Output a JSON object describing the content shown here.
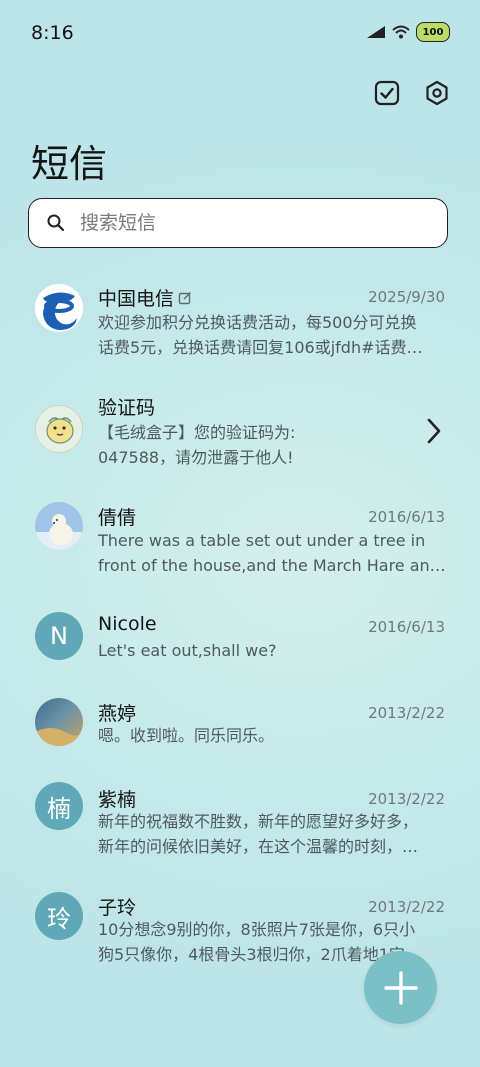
{
  "status": {
    "time": "8:16",
    "battery": "100"
  },
  "header": {
    "title": "短信"
  },
  "search": {
    "placeholder": "搜索短信"
  },
  "messages": [
    {
      "name": "中国电信",
      "date": "2025/9/30",
      "line1": "欢迎参加积分兑换话费活动，每500分可兑换",
      "line2": "话费5元，兑换话费请回复106或jfdh#话费…"
    },
    {
      "name": "验证码",
      "date": "",
      "line1": "【毛绒盒子】您的验证码为:",
      "line2": "047588，请勿泄露于他人!"
    },
    {
      "name": "倩倩",
      "date": "2016/6/13",
      "line1": "There was a table set out under a tree in",
      "line2": "front of the house,and the March Hare an…"
    },
    {
      "name": "Nicole",
      "date": "2016/6/13",
      "avatar_letter": "N",
      "line1": "Let's eat out,shall we?"
    },
    {
      "name": "燕婷",
      "date": "2013/2/22",
      "line1": "嗯。收到啦。同乐同乐。"
    },
    {
      "name": "紫楠",
      "date": "2013/2/22",
      "avatar_letter": "楠",
      "line1": "新年的祝福数不胜数，新年的愿望好多好多，",
      "line2": "新年的问候依旧美好，在这个温馨的时刻，…"
    },
    {
      "name": "子玲",
      "date": "2013/2/22",
      "avatar_letter": "玲",
      "line1": "10分想念9别的你，8张照片7张是你，6只小",
      "line2": "狗5只像你，4根骨头3根归你，2爪着地1定…"
    }
  ],
  "icons": {
    "signal": "signal-icon",
    "wifi": "wifi-icon",
    "battery": "battery-icon",
    "select": "checkbox-icon",
    "settings": "settings-icon",
    "search": "search-icon",
    "compose": "plus-icon"
  }
}
